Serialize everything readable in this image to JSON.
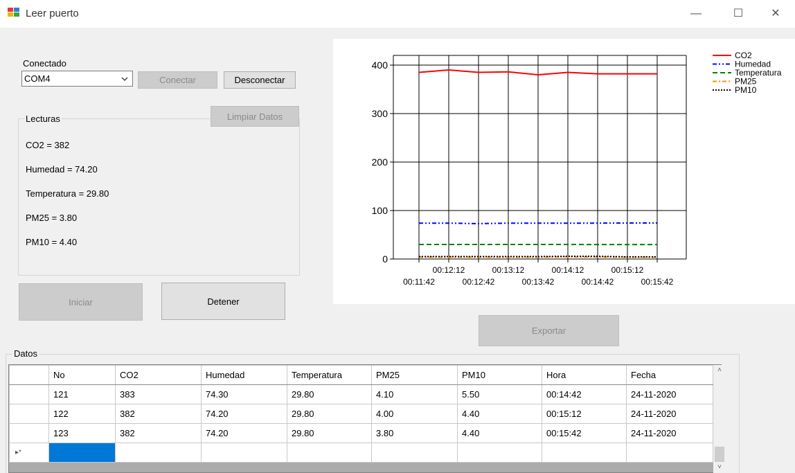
{
  "window": {
    "title": "Leer puerto",
    "minimize": "—",
    "maximize": "☐",
    "close": "✕"
  },
  "connection": {
    "status_label": "Conectado",
    "port_value": "COM4",
    "connect_label": "Conectar",
    "disconnect_label": "Desconectar"
  },
  "readings": {
    "group_title": "Lecturas",
    "clear_label": "Limpiar Datos",
    "co2": "CO2 = 382",
    "humidity": "Humedad = 74.20",
    "temperature": "Temperatura = 29.80",
    "pm25": "PM25 = 3.80",
    "pm10": "PM10 = 4.40"
  },
  "controls": {
    "start_label": "Iniciar",
    "stop_label": "Detener",
    "export_label": "Exportar"
  },
  "chart_data": {
    "type": "line",
    "title": "",
    "xlabel": "",
    "ylabel": "",
    "x": [
      "00:11:42",
      "00:12:12",
      "00:12:42",
      "00:13:12",
      "00:13:42",
      "00:14:12",
      "00:14:42",
      "00:15:12",
      "00:15:42"
    ],
    "xtick_labels_top": [
      "00:12:12",
      "00:13:12",
      "00:14:12",
      "00:15:12"
    ],
    "xtick_labels_bottom": [
      "00:11:42",
      "00:12:42",
      "00:13:42",
      "00:14:42",
      "00:15:42"
    ],
    "yticks": [
      0,
      100,
      200,
      300,
      400
    ],
    "ylim": [
      0,
      420
    ],
    "grid": true,
    "legend_position": "top-right",
    "series": [
      {
        "name": "CO2",
        "color": "#ff0000",
        "style": "solid",
        "values": [
          385,
          390,
          385,
          386,
          380,
          385,
          382,
          382,
          382
        ]
      },
      {
        "name": "Humedad",
        "color": "#0000ff",
        "style": "dash-dot-dot",
        "values": [
          74,
          74,
          73,
          74,
          74,
          74,
          74,
          74.2,
          74.2
        ]
      },
      {
        "name": "Temperatura",
        "color": "#008000",
        "style": "dashed",
        "values": [
          30,
          30,
          30,
          30,
          30,
          30,
          29.8,
          29.8,
          29.8
        ]
      },
      {
        "name": "PM25",
        "color": "#ff8c00",
        "style": "dash-dot",
        "values": [
          4,
          4,
          4,
          4,
          4,
          4.5,
          4.1,
          4,
          3.8
        ]
      },
      {
        "name": "PM10",
        "color": "#000000",
        "style": "dotted",
        "values": [
          5,
          5,
          5,
          5,
          5,
          5.5,
          5.5,
          4.4,
          4.4
        ]
      }
    ]
  },
  "table": {
    "group_title": "Datos",
    "columns": [
      "No",
      "CO2",
      "Humedad",
      "Temperatura",
      "PM25",
      "PM10",
      "Hora",
      "Fecha"
    ],
    "rows": [
      [
        "121",
        "383",
        "74.30",
        "29.80",
        "4.10",
        "5.50",
        "00:14:42",
        "24-11-2020"
      ],
      [
        "122",
        "382",
        "74.20",
        "29.80",
        "4.00",
        "4.40",
        "00:15:12",
        "24-11-2020"
      ],
      [
        "123",
        "382",
        "74.20",
        "29.80",
        "3.80",
        "4.40",
        "00:15:42",
        "24-11-2020"
      ]
    ],
    "new_row_marker": "▸*"
  },
  "colors": {
    "accent_selected": "#0078d7",
    "window_bg": "#f0f0f0"
  }
}
